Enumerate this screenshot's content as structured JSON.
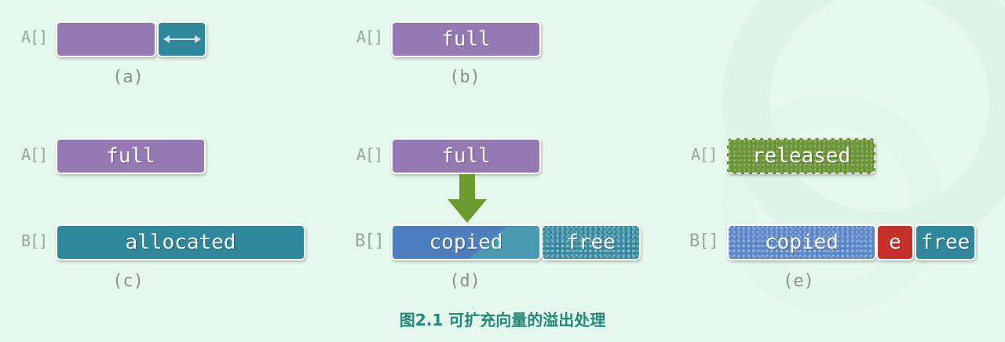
{
  "labels": {
    "a": "A[]",
    "b": "B[]"
  },
  "panels": {
    "a": {
      "caption": "(a)"
    },
    "b": {
      "caption": "(b)",
      "box": "full"
    },
    "c": {
      "caption": "(c)",
      "a_box": "full",
      "b_box": "allocated"
    },
    "d": {
      "caption": "(d)",
      "a_box": "full",
      "b_copied": "copied",
      "b_free": "free"
    },
    "e": {
      "caption": "(e)",
      "a_box": "released",
      "b_copied": "copied",
      "b_e": "e",
      "b_free": "free"
    }
  },
  "figure_caption": "图2.1 可扩充向量的溢出处理",
  "colors": {
    "purple": "#9479b3",
    "teal": "#2f879c",
    "blue": "#4f7ebf",
    "green": "#6f9a3a",
    "red": "#c8302c",
    "arrow": "#6b9a2e",
    "caption": "#1f8a7a"
  },
  "icons": {
    "expand_arrow": "double-arrow-icon",
    "copy_arrow": "down-arrow-icon"
  }
}
